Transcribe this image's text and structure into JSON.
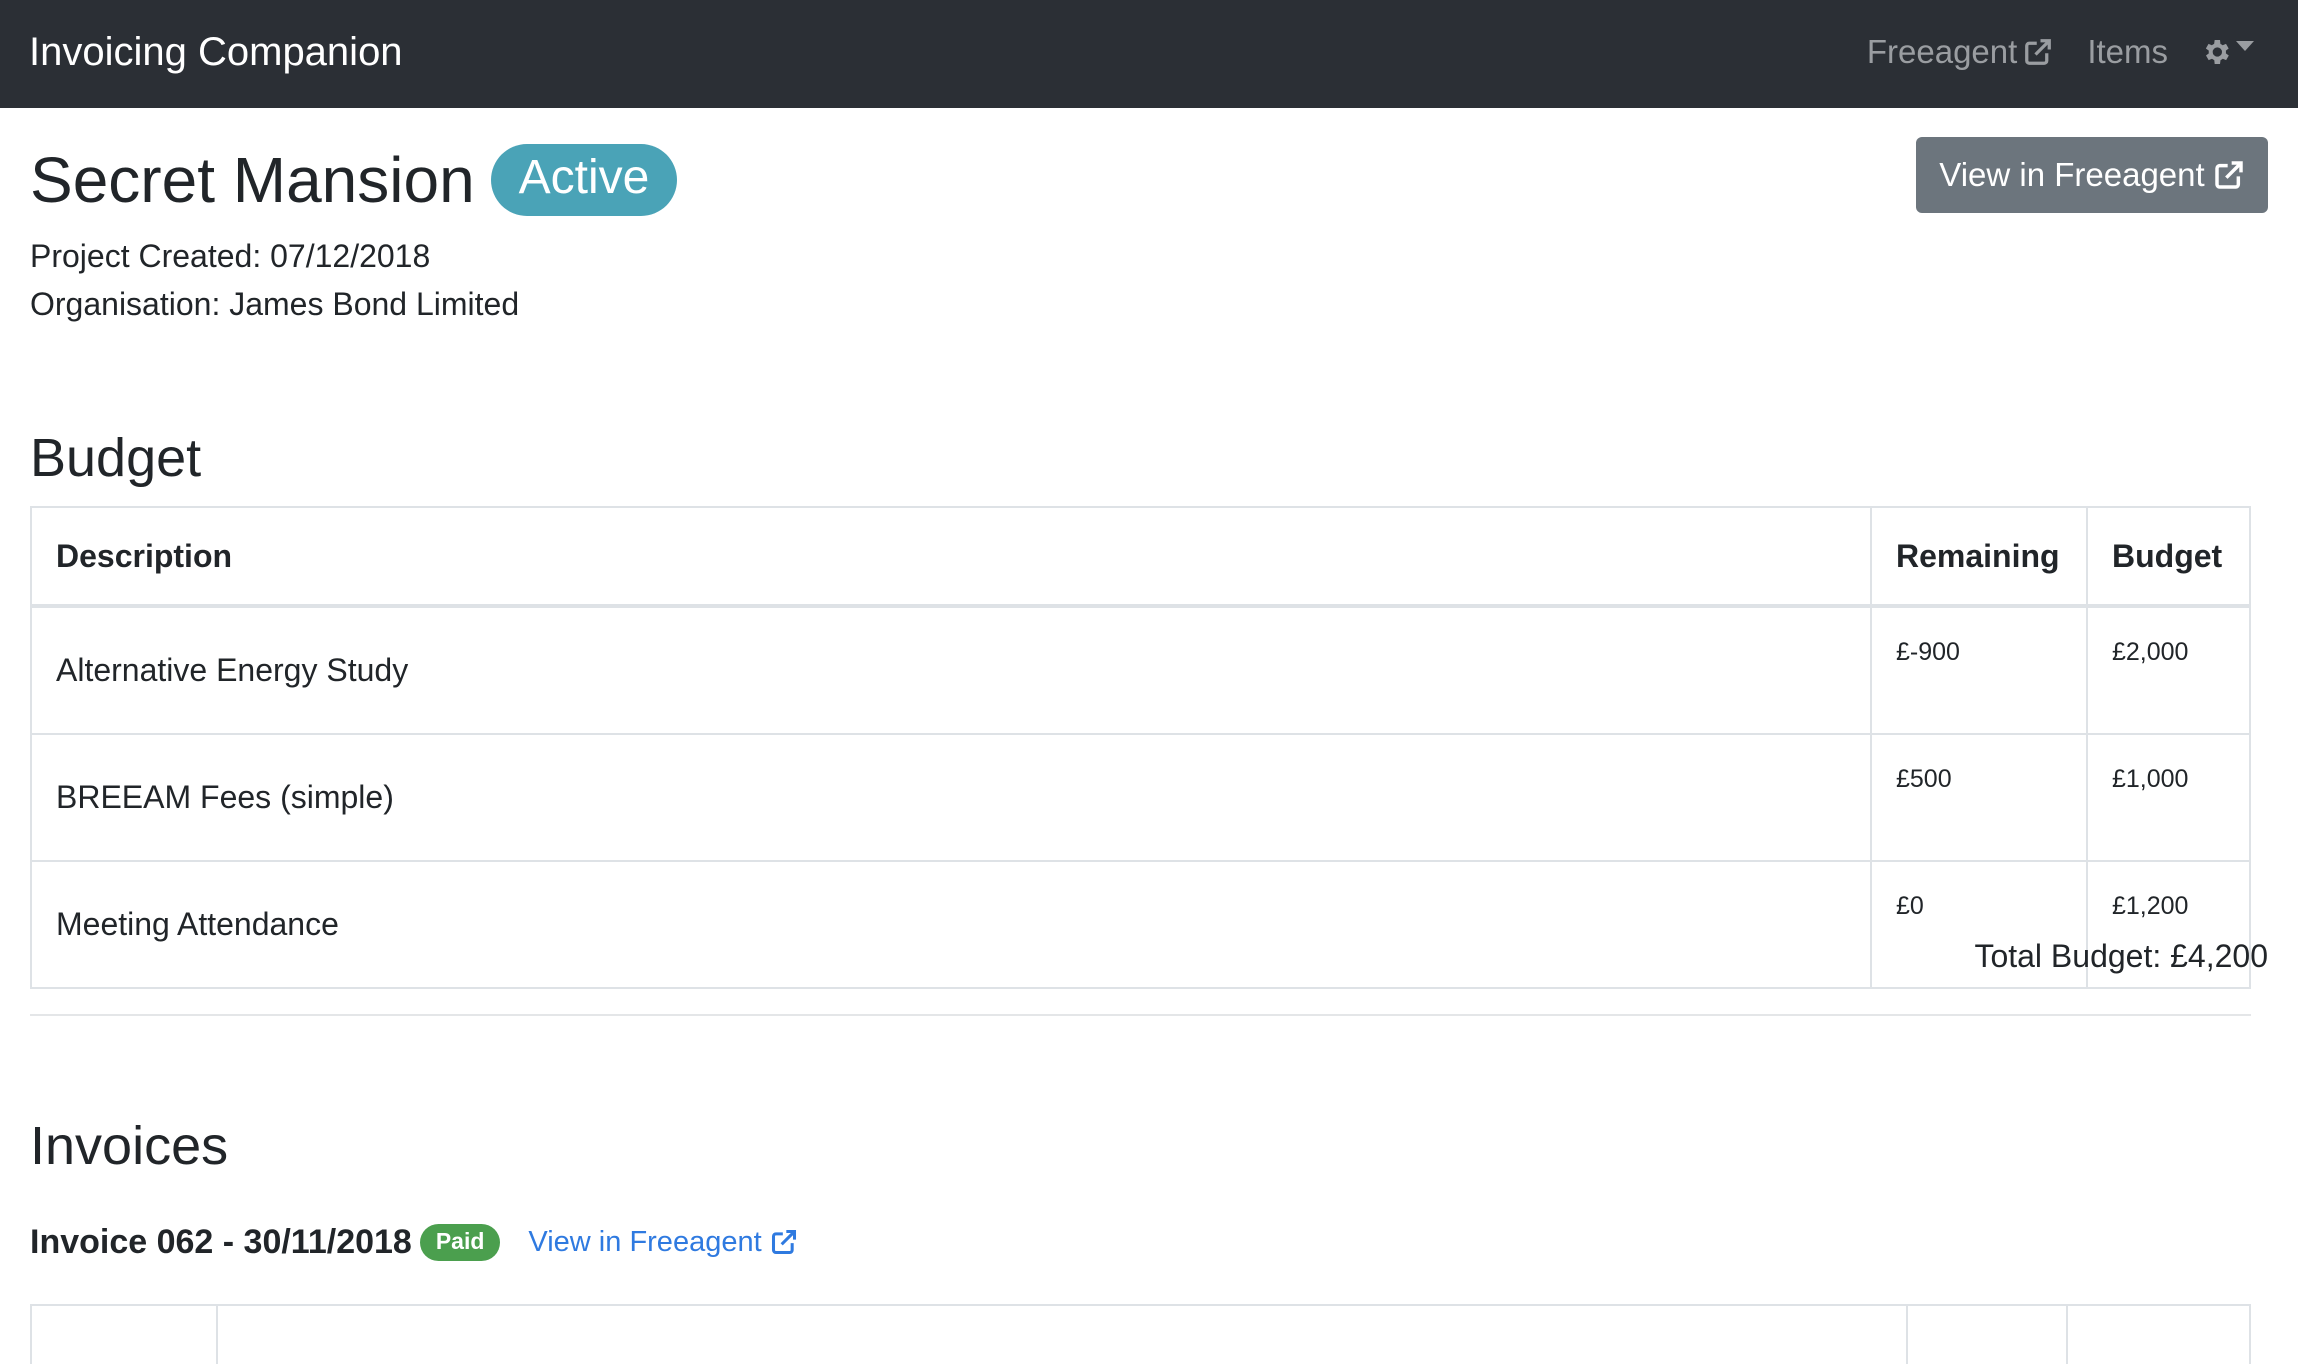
{
  "navbar": {
    "brand": "Invoicing Companion",
    "links": [
      {
        "label": "Freeagent",
        "icon": "external-link-icon"
      },
      {
        "label": "Items"
      }
    ],
    "settings_icon": "gear-icon"
  },
  "project": {
    "title": "Secret Mansion",
    "status": "Active",
    "view_button": "View in Freeagent",
    "created": "Project Created: 07/12/2018",
    "organisation": "Organisation: James Bond Limited"
  },
  "budget": {
    "heading": "Budget",
    "columns": [
      "Description",
      "Remaining",
      "Budget"
    ],
    "rows": [
      {
        "description": "Alternative Energy Study",
        "remaining": "£-900",
        "budget": "£2,000"
      },
      {
        "description": "BREEAM Fees (simple)",
        "remaining": "£500",
        "budget": "£1,000"
      },
      {
        "description": "Meeting Attendance",
        "remaining": "£0",
        "budget": "£1,200"
      }
    ],
    "total": "Total Budget: £4,200"
  },
  "invoices": {
    "heading": "Invoices",
    "items": [
      {
        "title": "Invoice 062 - 30/11/2018",
        "status": "Paid",
        "link": "View in Freeagent"
      }
    ]
  },
  "colors": {
    "navbar_bg": "#2b2f35",
    "status_active": "#4aa3b7",
    "status_paid": "#4b9f4e",
    "link": "#2f7ae0",
    "button_secondary": "#6c757d"
  }
}
